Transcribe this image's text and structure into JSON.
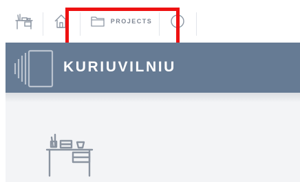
{
  "topbar": {
    "items": [
      {
        "icon": "desk-icon"
      },
      {
        "icon": "home-icon"
      },
      {
        "icon": "folder-icon",
        "label": "PROJECTS"
      },
      {
        "icon": "info-icon"
      }
    ]
  },
  "annotation": {
    "color": "#ee1111"
  },
  "brand": {
    "title": "KURIUVILNIU",
    "logo_icon": "book-stack-logo",
    "banner_color": "#667b94"
  },
  "content": {
    "background": "#f3f4f6",
    "illustration": "desk-illustration"
  }
}
